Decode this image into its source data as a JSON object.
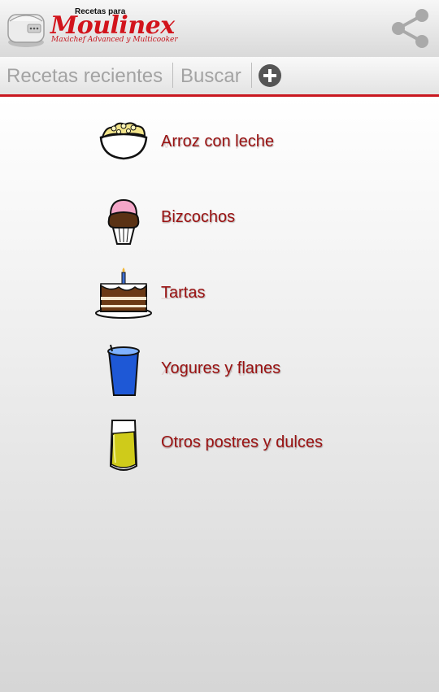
{
  "header": {
    "logo_small": "Recetas para",
    "logo_brand": "Moulinex",
    "logo_sub": "Maxichef Advanced y Multicooker",
    "share_icon": "share-icon"
  },
  "tabs": [
    {
      "label": "Recetas recientes"
    },
    {
      "label": "Buscar"
    }
  ],
  "add_icon": "plus-circle-icon",
  "categories": [
    {
      "label": "Arroz con leche",
      "icon": "rice-pudding-bowl-icon"
    },
    {
      "label": "Bizcochos",
      "icon": "cupcake-icon"
    },
    {
      "label": "Tartas",
      "icon": "birthday-cake-icon"
    },
    {
      "label": "Yogures y flanes",
      "icon": "yogurt-cup-icon"
    },
    {
      "label": "Otros postres y dulces",
      "icon": "glass-dessert-icon"
    }
  ],
  "colors": {
    "brand_red": "#d2141c",
    "label_red": "#9a1212",
    "tab_text": "#a3a3a3"
  }
}
